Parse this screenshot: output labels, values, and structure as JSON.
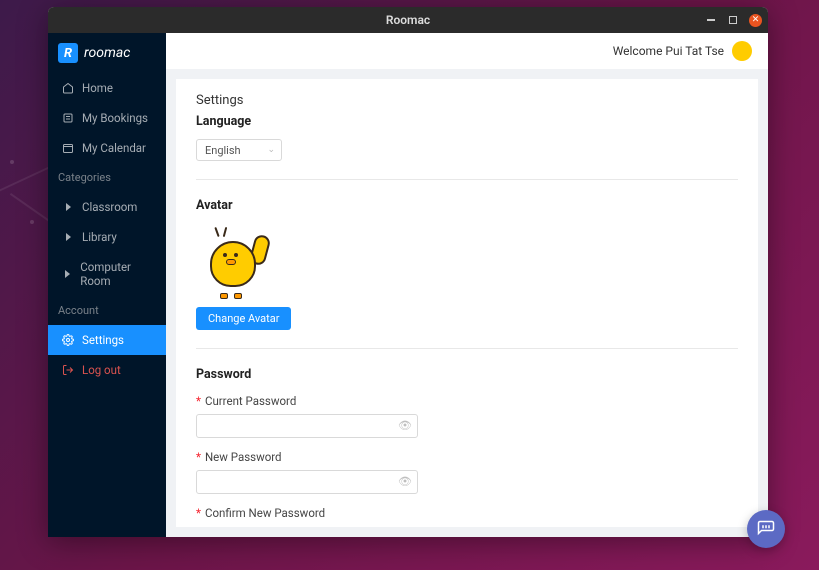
{
  "window": {
    "title": "Roomac"
  },
  "brand": {
    "name": "roomac",
    "icon_letter": "R"
  },
  "sidebar": {
    "items": [
      {
        "label": "Home"
      },
      {
        "label": "My Bookings"
      },
      {
        "label": "My Calendar"
      }
    ],
    "categories_header": "Categories",
    "categories": [
      {
        "label": "Classroom"
      },
      {
        "label": "Library"
      },
      {
        "label": "Computer Room"
      }
    ],
    "account_header": "Account",
    "account": [
      {
        "label": "Settings"
      },
      {
        "label": "Log out"
      }
    ]
  },
  "header": {
    "welcome": "Welcome Pui Tat Tse"
  },
  "settings": {
    "title": "Settings",
    "language_heading": "Language",
    "language_value": "English",
    "avatar_heading": "Avatar",
    "change_avatar": "Change Avatar",
    "password_heading": "Password",
    "current_password_label": "Current Password",
    "new_password_label": "New Password",
    "confirm_password_label": "Confirm New Password"
  }
}
